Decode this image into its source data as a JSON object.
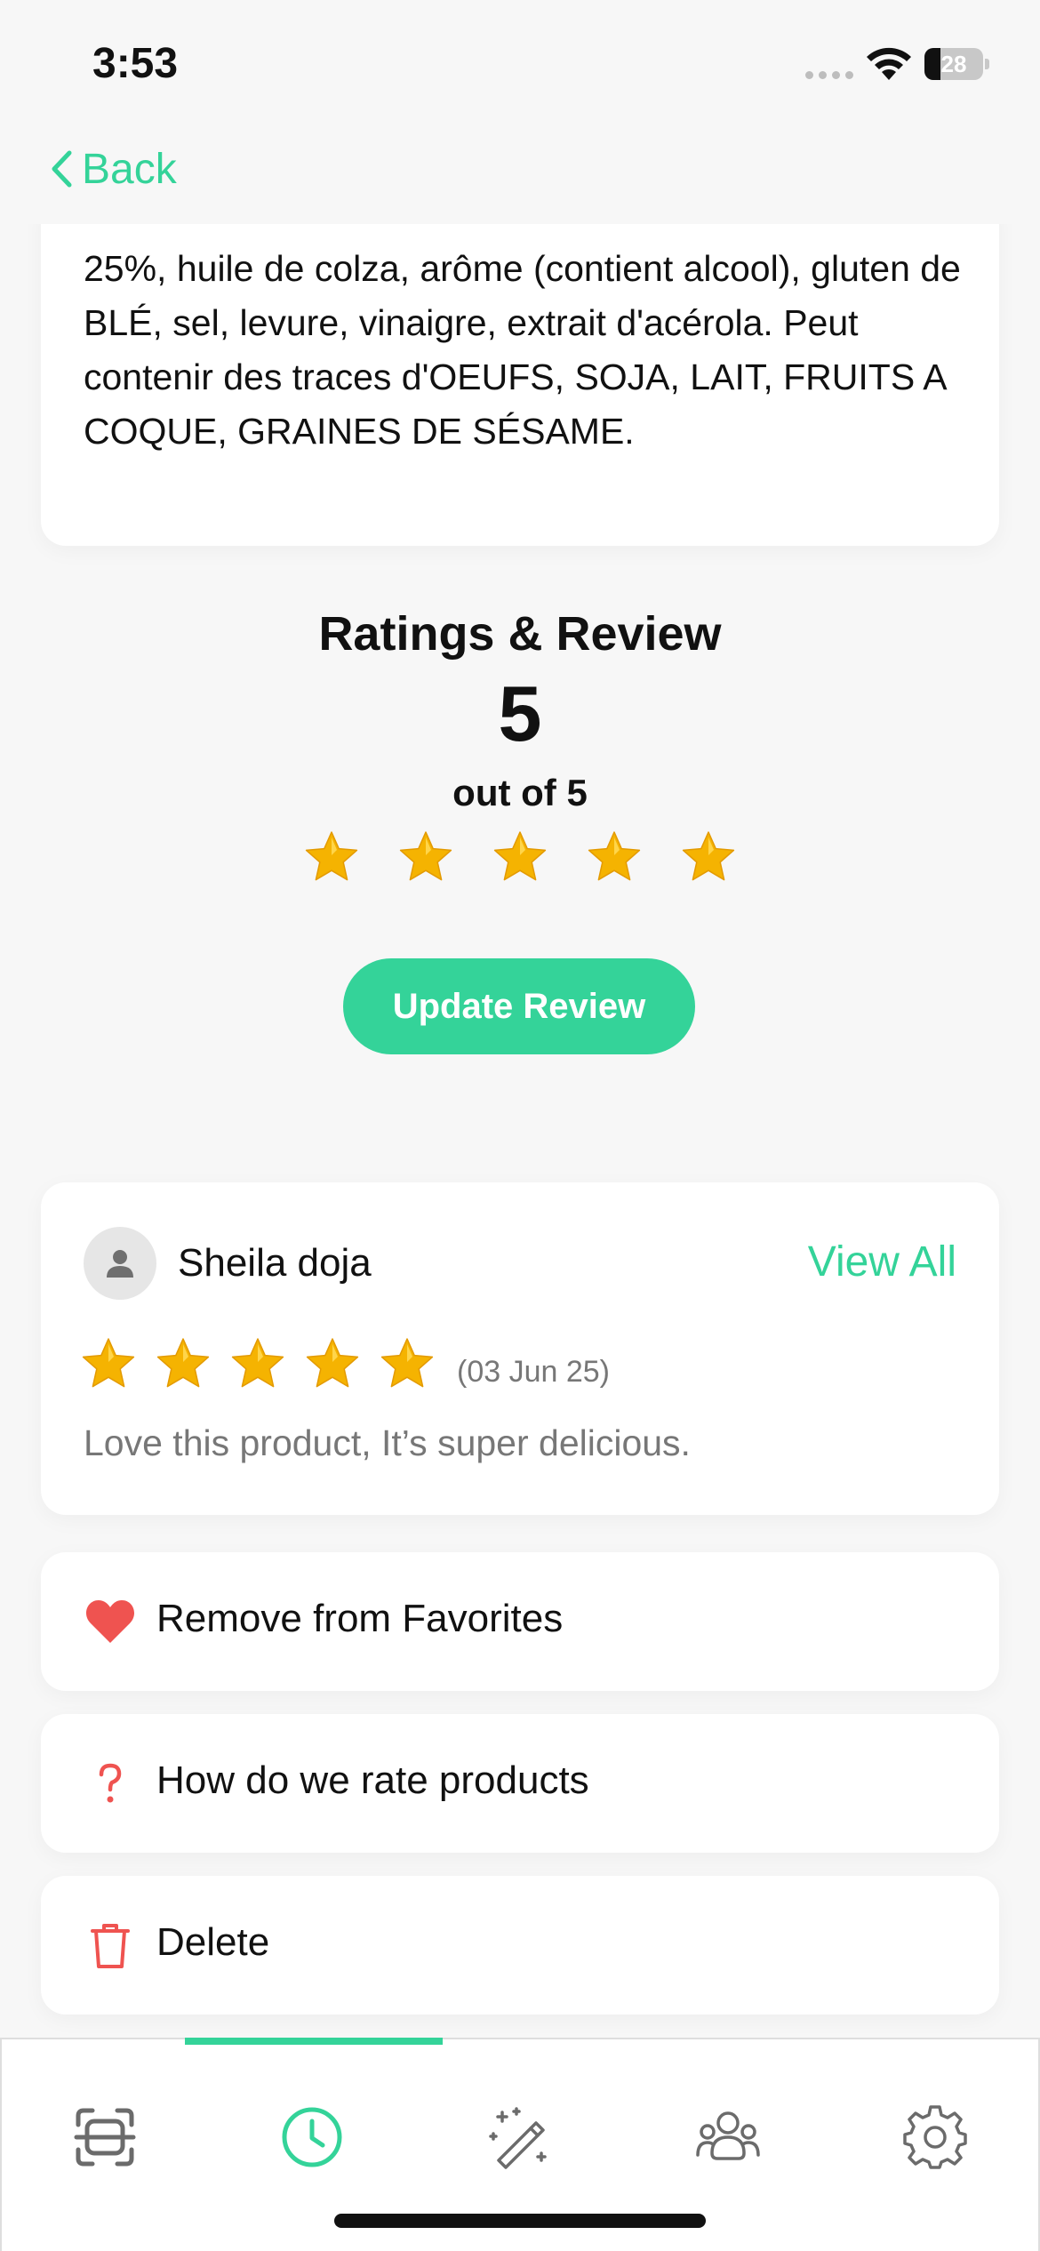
{
  "status_bar": {
    "time": "3:53",
    "battery_level": 28,
    "battery_text": "28"
  },
  "nav": {
    "back_label": "Back"
  },
  "ingredients": {
    "text": "25%, huile de colza, arôme (contient alcool), gluten de BLÉ, sel, levure, vinaigre, extrait d'acérola. Peut contenir des traces d'OEUFS, SOJA, LAIT, FRUITS A COQUE, GRAINES DE SÉSAME."
  },
  "ratings": {
    "title": "Ratings & Review",
    "value": "5",
    "out_of": "out of 5",
    "stars": 5,
    "update_button": "Update Review"
  },
  "review": {
    "reviewer": "Sheila doja",
    "view_all": "View All",
    "stars": 5,
    "date": "(03 Jun 25)",
    "text": "Love this product, It’s super delicious."
  },
  "actions": {
    "favorites": "Remove from Favorites",
    "how_rate": "How do we rate products",
    "delete": "Delete"
  },
  "tabs": [
    {
      "icon": "scan-icon",
      "active": false
    },
    {
      "icon": "history-clock-icon",
      "active": true
    },
    {
      "icon": "magic-wand-icon",
      "active": false
    },
    {
      "icon": "community-icon",
      "active": false
    },
    {
      "icon": "settings-gear-icon",
      "active": false
    }
  ],
  "colors": {
    "accent": "#34d399",
    "danger": "#ef5350",
    "star": "#f5b301",
    "muted_text": "#777777"
  }
}
